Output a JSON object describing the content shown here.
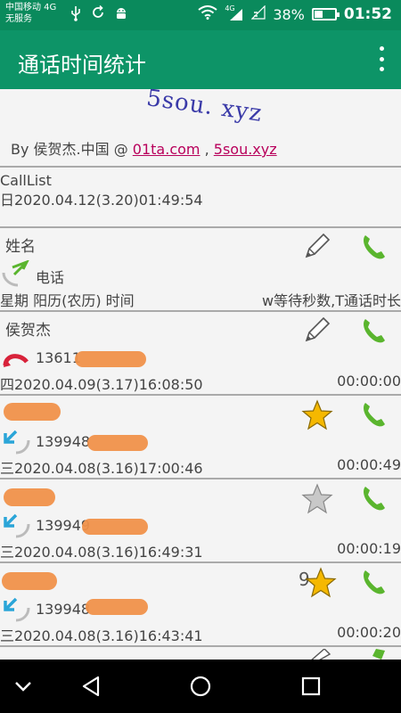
{
  "status_bar": {
    "carrier_line1": "中国移动 4G",
    "carrier_line2": "无服务",
    "battery": "38%",
    "battery_level": 0.38,
    "time": "01:52",
    "signal_label": "4G"
  },
  "app_bar": {
    "title": "通话时间统计"
  },
  "header": {
    "captcha_text": "5sou. xyz",
    "byline_prefix": "By 侯贺杰.中国 @ ",
    "link1": "01ta.com",
    "separator": " , ",
    "link2": "5sou.xyz"
  },
  "calllist": {
    "title": "CallList",
    "date": "日2020.04.12(3.20)01:49:54"
  },
  "column_header": {
    "name_label": "姓名",
    "phone_label": "电话",
    "date_label": "星期 阳历(农历) 时间",
    "duration_label": "w等待秒数,T通话时长"
  },
  "rows": [
    {
      "name": "侯贺杰",
      "number": "13611",
      "date": "四2020.04.09(3.17)16:08:50",
      "duration": "00:00:00",
      "type": "outgoing-missed",
      "star": "none"
    },
    {
      "name": "",
      "number": "139948",
      "date": "三2020.04.08(3.16)17:00:46",
      "duration": "00:00:49",
      "type": "incoming",
      "star": "gold"
    },
    {
      "name": "",
      "number": "139949",
      "date": "三2020.04.08(3.16)16:49:31",
      "duration": "00:00:19",
      "type": "incoming",
      "star": "gray"
    },
    {
      "name": "",
      "number": "139948",
      "date": "三2020.04.08(3.16)16:43:41",
      "duration": "00:00:20",
      "type": "incoming",
      "star": "gold",
      "star_count": "9"
    }
  ],
  "colors": {
    "status_bar": "#0a8a5c",
    "app_bar": "#0d9467",
    "link": "#b8005b",
    "phone_green": "#5ab52e",
    "star_gold": "#f5b800"
  }
}
